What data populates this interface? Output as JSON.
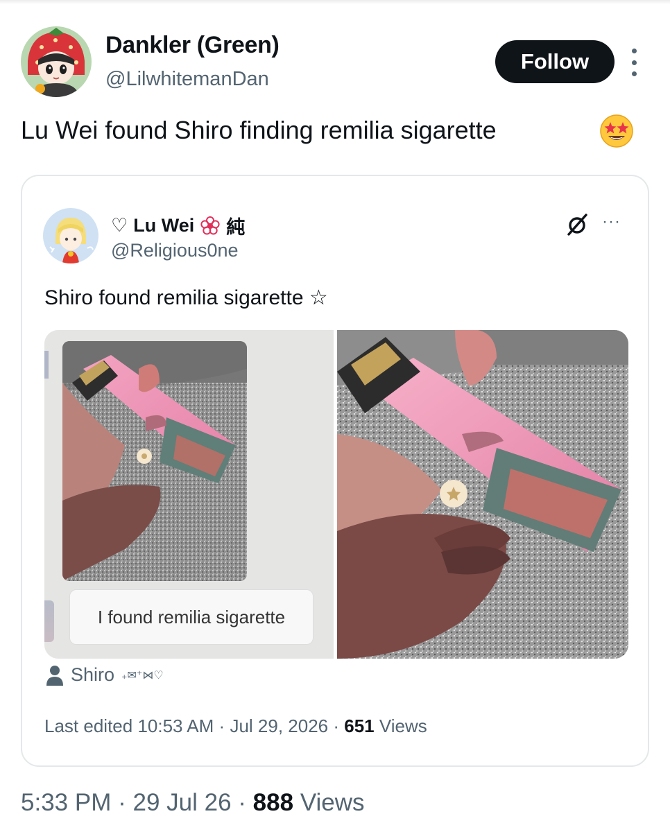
{
  "author": {
    "display_name": "Dankler (Green)",
    "handle": "@LilwhitemanDan",
    "follow_label": "Follow"
  },
  "tweet": {
    "text": "Lu Wei found Shiro finding remilia sigarette",
    "emoji": "star-struck-emoji",
    "time": "5:33 PM",
    "date": "29 Jul 26",
    "views_count": "888",
    "views_label": "Views",
    "separator": "·"
  },
  "quoted": {
    "name_prefix": "♡",
    "display_name": "Lu Wei",
    "name_suffix": "純",
    "handle": "@Religious0ne",
    "more_label": "···",
    "text": "Shiro found remilia sigarette ☆",
    "media": {
      "left_bubble_text": "I found remilia sigarette"
    },
    "tagged_user": "Shiro",
    "tagged_deco": "₊✉︎⁺⋈♡",
    "meta": {
      "prefix": "Last edited",
      "time": "10:53 AM",
      "date": "Jul 29, 2026",
      "views_count": "651",
      "views_label": "Views"
    }
  },
  "icons": {
    "avatar": "strawberry-girl-avatar",
    "quoted_avatar": "blonde-character-avatar",
    "grok": "grok-icon",
    "kebab": "more-vertical-icon",
    "tag": "person-icon",
    "verified": "flower-badge-icon"
  },
  "colors": {
    "text": "#0f1419",
    "secondary": "#536471",
    "button": "#0f1419",
    "border": "#e4e8ea"
  }
}
